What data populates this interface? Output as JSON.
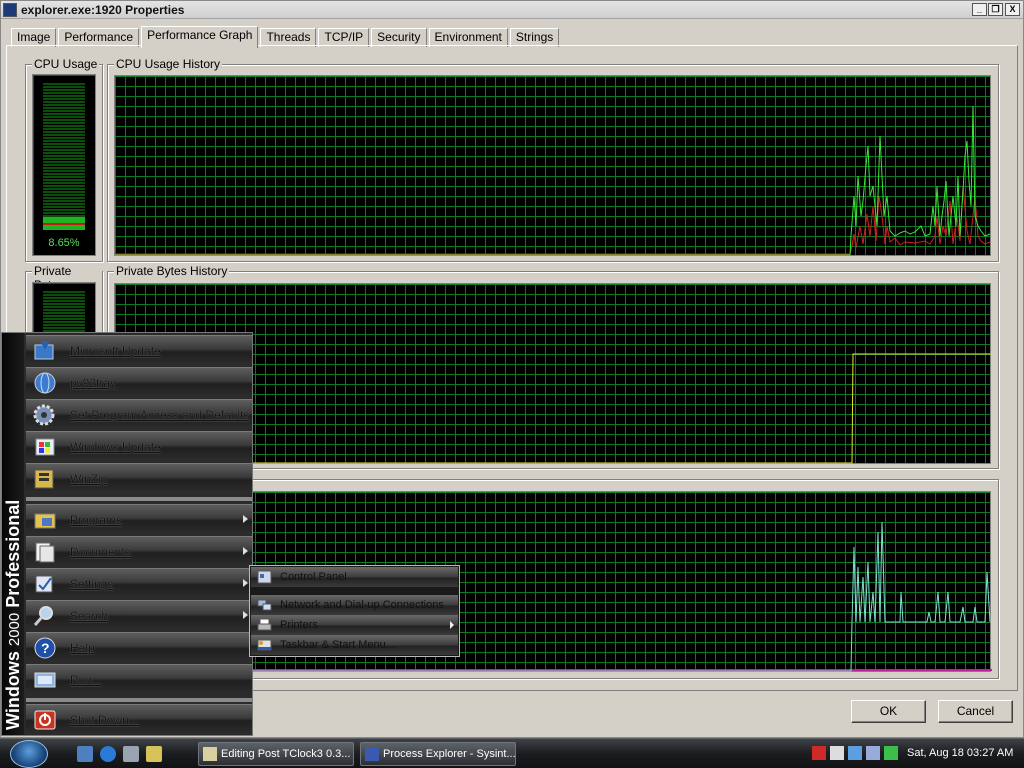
{
  "window": {
    "title": "explorer.exe:1920 Properties",
    "controls": {
      "minimize": "_",
      "restore": "❐",
      "close": "X"
    }
  },
  "tabs": [
    "Image",
    "Performance",
    "Performance Graph",
    "Threads",
    "TCP/IP",
    "Security",
    "Environment",
    "Strings"
  ],
  "active_tab": "Performance Graph",
  "cpu": {
    "usage_label": "CPU Usage",
    "usage_value": "8.65%",
    "usage_fraction": 0.0865,
    "history_label": "CPU Usage History"
  },
  "private_bytes": {
    "label": "Private Bytes",
    "history_label": "Private Bytes History"
  },
  "buttons": {
    "ok": "OK",
    "cancel": "Cancel"
  },
  "start_menu": {
    "banner_brand": "Windows",
    "banner_version": "2000",
    "banner_edition": "Professional",
    "pinned": [
      "Microsoft Update",
      "pv92tray",
      "Set Program Access and Defaults",
      "Windows Update",
      "WinZip"
    ],
    "main": [
      "Programs",
      "Documents",
      "Settings",
      "Search",
      "Help",
      "Run..."
    ],
    "shutdown": "Shut Down..."
  },
  "settings_submenu": [
    "Control Panel",
    "Network and Dial-up Connections",
    "Printers",
    "Taskbar & Start Menu..."
  ],
  "taskbar": {
    "tasks": [
      "Editing Post TClock3 0.3...",
      "Process Explorer - Sysint..."
    ],
    "clock": "Sat, Aug 18 03:27 AM"
  },
  "colors": {
    "graph_bg": "#000000",
    "grid": "#0d7a24",
    "cpu_line": "#39e63a",
    "kernel_line": "#d02020",
    "private_line": "#e6e62a",
    "io_line": "#7fe0d0",
    "io_base": "#c020a0"
  }
}
